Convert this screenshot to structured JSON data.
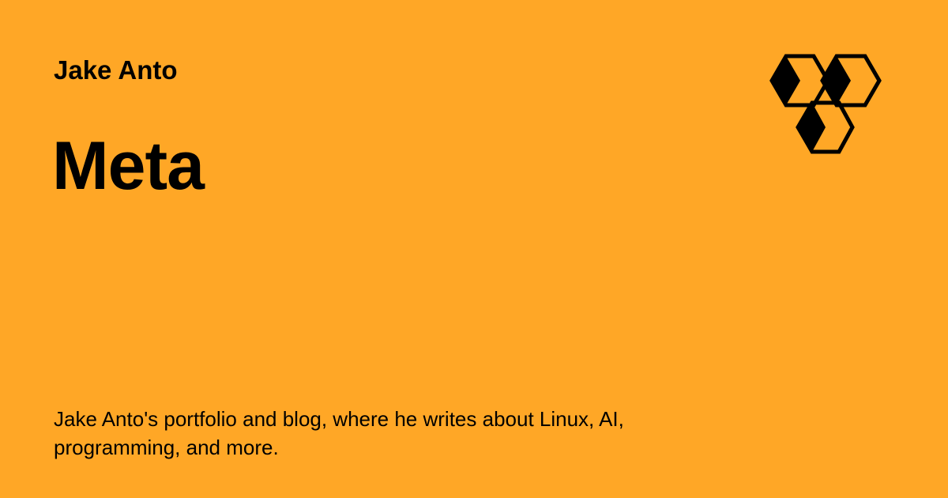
{
  "card": {
    "site_name": "Jake Anto",
    "title": "Meta",
    "description": "Jake Anto's portfolio and blog, where he writes about Linux, AI, programming, and more.",
    "background_color": "#FFA726",
    "text_color": "#000000"
  },
  "logo": {
    "icon": "hexagon-cluster-logo-icon"
  }
}
